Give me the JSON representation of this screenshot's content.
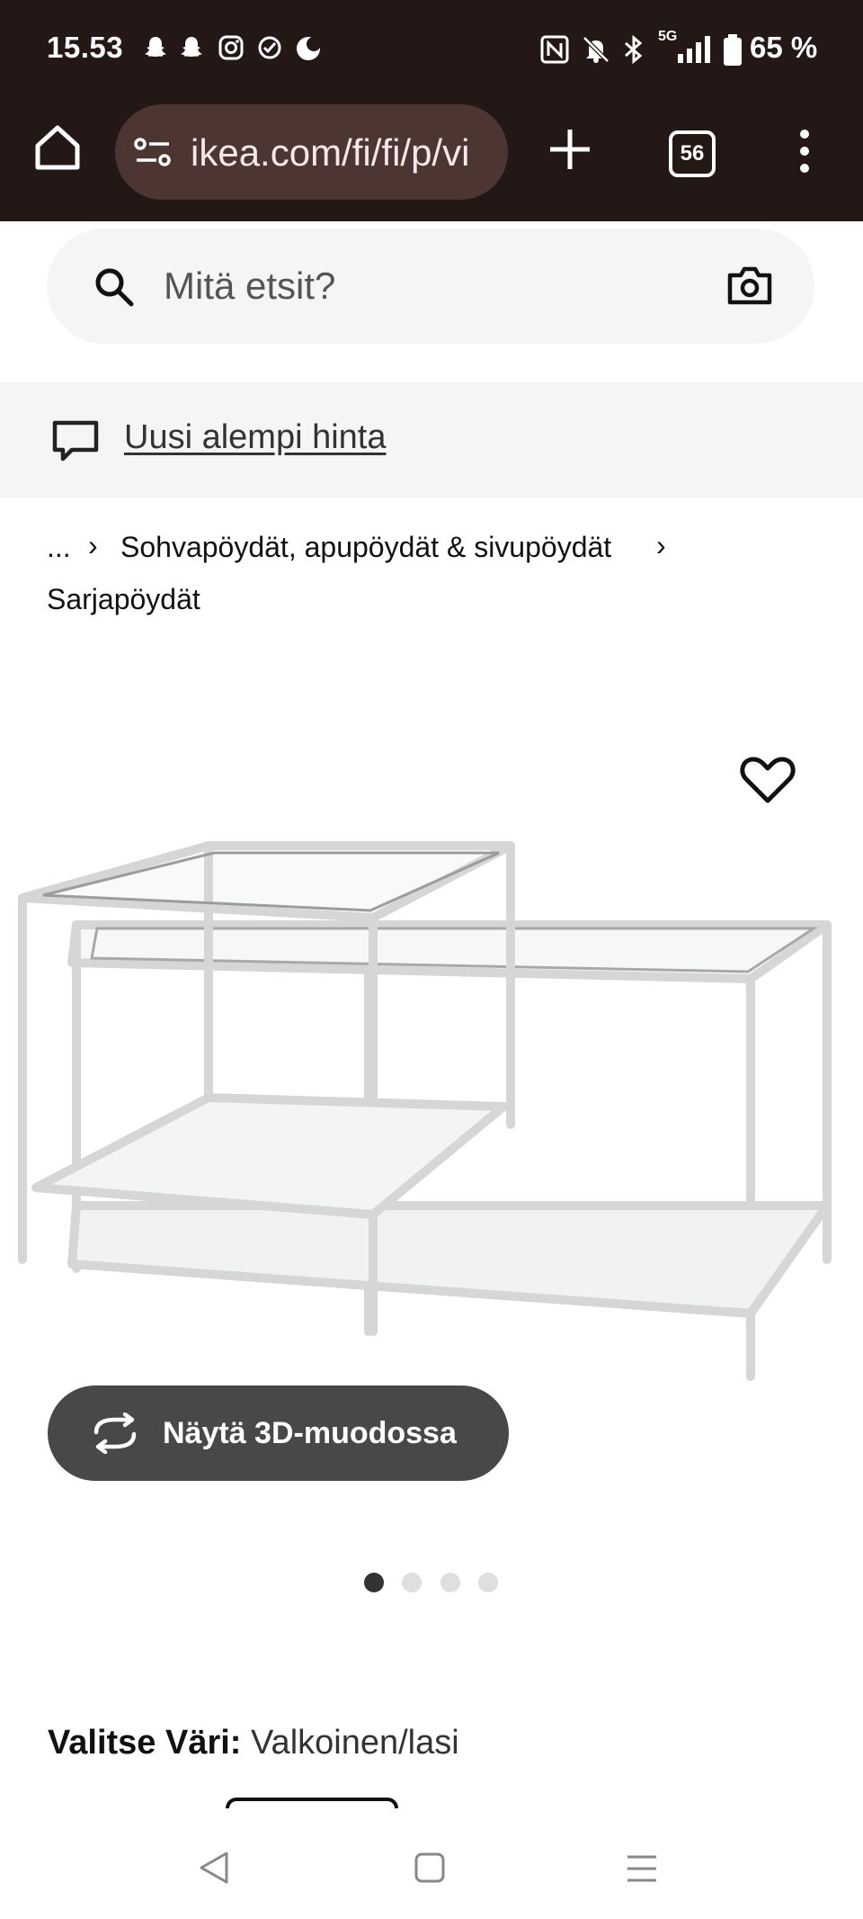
{
  "status_bar": {
    "time": "15.53",
    "battery": "65 %",
    "network": "5G",
    "left_icons": [
      "snapchat-icon",
      "snapchat-icon",
      "instagram-icon",
      "check-circle-icon",
      "moon-icon"
    ],
    "right_icons": [
      "nfc-icon",
      "bell-off-icon",
      "bluetooth-icon",
      "signal-icon",
      "battery-icon"
    ]
  },
  "browser": {
    "url": "ikea.com/fi/fi/p/vi",
    "tab_count": "56"
  },
  "search": {
    "placeholder": "Mitä etsit?"
  },
  "promo": {
    "text": "Uusi alempi hinta"
  },
  "breadcrumb": {
    "ellipsis": "...",
    "separator": "›",
    "level1": "Sohvapöydät, apupöydät & sivupöydät",
    "level2": "Sarjapöydät"
  },
  "product": {
    "view_3d_label": "Näytä 3D-muodossa",
    "image_count": 4,
    "active_image": 1,
    "color_label": "Valitse Väri:",
    "color_value": "Valkoinen/lasi"
  },
  "colors": {
    "status_bg": "#241817",
    "url_bg": "#4d3532",
    "button_dark": "#484848",
    "promo_bg": "#f5f5f5"
  }
}
